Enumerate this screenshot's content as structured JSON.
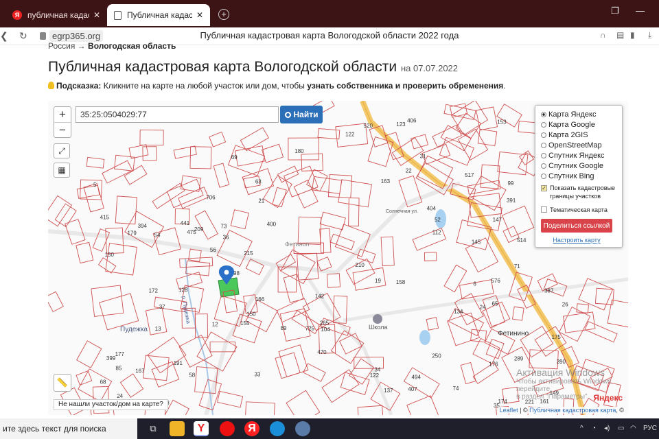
{
  "browser": {
    "tabs": [
      {
        "label": "публичная кадастровая к",
        "active": false
      },
      {
        "label": "Публичная кадастровая ",
        "active": true
      }
    ],
    "url": "egrp365.org",
    "page_title": "Публичная кадастровая карта Вологодской области 2022 года"
  },
  "page": {
    "breadcrumb_root": "Россия →",
    "breadcrumb_current": "Вологодская область",
    "title": "Публичная кадастровая карта Вологодской области",
    "title_date": "на 07.07.2022",
    "hint_label": "Подсказка:",
    "hint_text": " Кликните на карте на любой участок или дом, чтобы ",
    "hint_bold": "узнать собственника и проверить обременения",
    "hint_end": "."
  },
  "map": {
    "zoom_in": "+",
    "zoom_out": "−",
    "search_value": "35:25:0504029:77",
    "find_label": "Найти",
    "layers": [
      "Карта Яндекс",
      "Карта Google",
      "Карта 2GIS",
      "OpenStreetMap",
      "Спутник Яндекс",
      "Спутник Google",
      "Спутник Bing"
    ],
    "selected_layer": "Карта Яндекс",
    "show_borders": "Показать кадастровые границы участков",
    "thematic": "Тематическая карта",
    "share_label": "Поделиться ссылкой",
    "configure_label": "Настроить карту",
    "not_found": "Не нашли участок/дом на карте?",
    "attrib_leaflet": "Leaflet",
    "attrib_rest": " | © ",
    "attrib_pkk": "Публичная кадастровая карта",
    "attrib_end": ", ©",
    "yandex": "Яндекс",
    "place_labels": {
      "pudega": "Пудежка",
      "fetinino": "Фетинино",
      "school": "Школа",
      "solnech": "Солнечная ул.",
      "river": "р. Пудежка",
      "fetino": "Фетиноп"
    },
    "activate_title": "Активация Windows",
    "activate_sub1": "Чтобы активировать Windows, перейдите",
    "activate_sub2": "в раздел \"Параметры\".",
    "parcel_numbers": [
      "142",
      "475",
      "576",
      "161",
      "69",
      "725",
      "98",
      "155",
      "145",
      "514",
      "520",
      "174",
      "215",
      "250",
      "210",
      "400",
      "221",
      "209",
      "494",
      "12",
      "289",
      "112",
      "122",
      "177",
      "99",
      "399",
      "150",
      "89",
      "167",
      "175",
      "517",
      "415",
      "394",
      "128",
      "33",
      "150",
      "149",
      "387",
      "74",
      "104",
      "85",
      "265",
      "706",
      "31",
      "137",
      "147",
      "158",
      "153",
      "404",
      "58",
      "13",
      "191",
      "123",
      "180",
      "5",
      "6",
      "176",
      "179",
      "163",
      "134",
      "166",
      "172",
      "441",
      "470",
      "391",
      "390",
      "34",
      "26",
      "54",
      "35",
      "36",
      "24",
      "24",
      "22",
      "37",
      "48",
      "122",
      "19",
      "21",
      "73",
      "406",
      "407",
      "56",
      "52",
      "63",
      "65",
      "68",
      "71"
    ]
  },
  "taskbar": {
    "search_placeholder": "ите здесь текст для поиска",
    "lang": "РУС"
  }
}
